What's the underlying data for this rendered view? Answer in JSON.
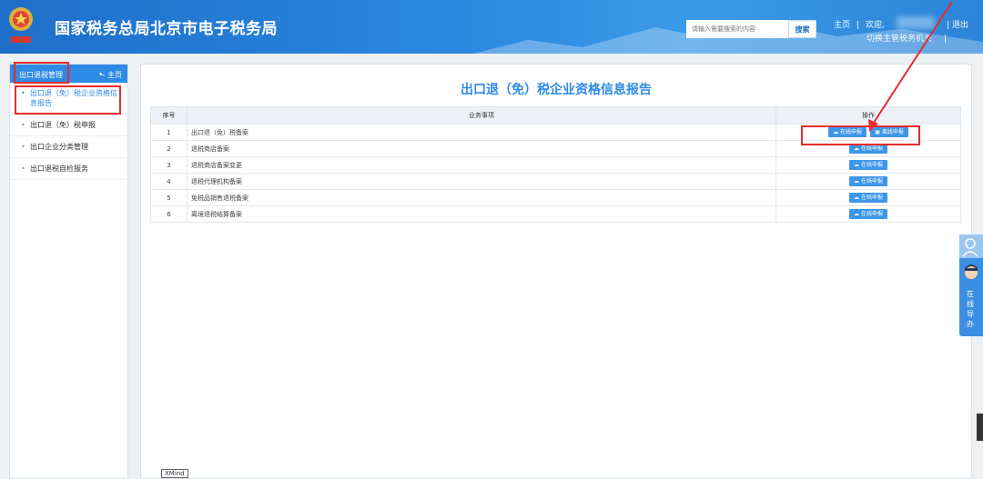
{
  "header": {
    "site_title": "国家税务总局北京市电子税务局",
    "emblem_name": "tax-emblem-icon",
    "search_placeholder": "请输入需要搜索的内容",
    "search_button": "搜索",
    "home_link": "主页",
    "separator": "|",
    "welcome": "欢迎,",
    "switch_org": "切换主管税务机关",
    "logout": "退出"
  },
  "sidebar": {
    "title": "出口退税管理",
    "home": "主页",
    "items": [
      {
        "label": "出口退（免）税企业资格信息报告",
        "active": true
      },
      {
        "label": "出口退（免）税申报",
        "active": false
      },
      {
        "label": "出口企业分类管理",
        "active": false
      },
      {
        "label": "出口退税自检服务",
        "active": false
      }
    ]
  },
  "main": {
    "title": "出口退（免）税企业资格信息报告",
    "columns": {
      "num": "序号",
      "item": "业务事项",
      "ops": "操作"
    },
    "online_btn": "在线申报",
    "offline_btn": "离线申报",
    "rows": [
      {
        "num": "1",
        "item": "出口退（免）税备案",
        "offline": true
      },
      {
        "num": "2",
        "item": "退税商店备案",
        "offline": false
      },
      {
        "num": "3",
        "item": "退税商店备案变更",
        "offline": false
      },
      {
        "num": "4",
        "item": "退税代理机构备案",
        "offline": false
      },
      {
        "num": "5",
        "item": "免税品销售退税备案",
        "offline": false
      },
      {
        "num": "6",
        "item": "离境退税结算备案",
        "offline": false
      }
    ],
    "xmind": "XMind"
  },
  "float_widget": {
    "text": "在线导办"
  },
  "colors": {
    "accent": "#2d8ae6",
    "header": "#1e6fc9",
    "annotation": "#e62b2b"
  }
}
